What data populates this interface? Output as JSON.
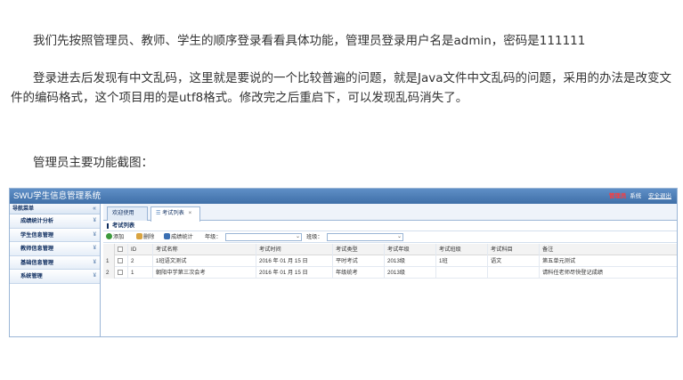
{
  "article": {
    "p1": "我们先按照管理员、教师、学生的顺序登录看看具体功能，管理员登录用户名是admin，密码是111111",
    "p2": "登录进去后发现有中文乱码，这里就是要说的一个比较普遍的问题，就是Java文件中文乱码的问题，采用的办法是改变文件的编码格式，这个项目用的是utf8格式。修改完之后重启下，可以发现乱码消失了。",
    "p3": "管理员主要功能截图："
  },
  "app": {
    "title": "SWU学生信息管理系统",
    "role": "管理员",
    "user": "系统",
    "logout": "安全退出"
  },
  "sidebar": {
    "heading": "导航菜单",
    "collapse_glyph": "«",
    "items": [
      {
        "label": "成绩统计分析"
      },
      {
        "label": "学生信息管理"
      },
      {
        "label": "教师信息管理"
      },
      {
        "label": "基础信息管理"
      },
      {
        "label": "系统管理"
      }
    ],
    "chevron_glyph": "¥"
  },
  "tabs": [
    {
      "label": "欢迎使用"
    },
    {
      "label": "考试列表"
    }
  ],
  "tab_close": "×",
  "panel": {
    "title": "考试列表"
  },
  "toolbar": {
    "add": "添加",
    "delete": "删除",
    "stats": "成绩统计",
    "grade_label": "年级：",
    "class_label": "班级："
  },
  "table": {
    "columns": [
      "ID",
      "考试名称",
      "考试时间",
      "考试类型",
      "考试年级",
      "考试班级",
      "考试科目",
      "备注"
    ],
    "rows": [
      {
        "num": "1",
        "cells": [
          "2",
          "1班语文测试",
          "2016 年 01 月 15 日",
          "平时考试",
          "2013级",
          "1班",
          "语文",
          "第五单元测试"
        ]
      },
      {
        "num": "2",
        "cells": [
          "1",
          "朝阳中学第三次会考",
          "2016 年 01 月 15 日",
          "年级统考",
          "2013级",
          "",
          "",
          "请科任老师尽快登记成绩"
        ]
      }
    ]
  },
  "colors": {
    "titlebar": "#4a7bb7",
    "role": "#ff3b3b",
    "border": "#9bb6d6"
  }
}
